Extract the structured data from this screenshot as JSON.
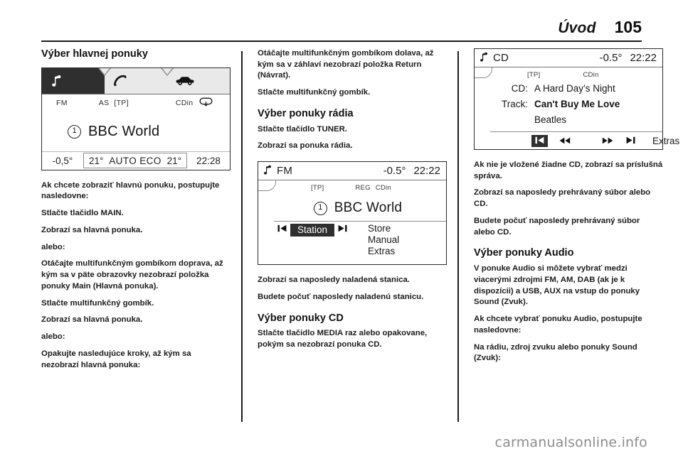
{
  "header": {
    "title": "Úvod",
    "page_number": "105"
  },
  "footer": {
    "watermark": "carmanualsonline.info"
  },
  "columns": {
    "left": {
      "heading": "Výber hlavnej ponuky",
      "paragraphs": [
        "Ak chcete zobraziť hlavnú ponuku, postupujte nasledovne:",
        "Stlačte tlačidlo MAIN.",
        "Zobrazí sa hlavná ponuka.",
        "alebo:",
        "Otáčajte multifunkčným gombíkom doprava, až kým sa v päte obrazovky nezobrazí položka ponuky Main (Hlavná ponuka).",
        "Stlačte multifunkčný gombík.",
        "Zobrazí sa hlavná ponuka.",
        "alebo:",
        "Opakujte nasledujúce kroky, až kým sa nezobrazí hlavná ponuka:"
      ]
    },
    "middle": {
      "paragraphs_top": [
        "Otáčajte multifunkčným gombíkom dolava, až kým sa v záhlaví nezobrazí položka Return (Návrat).",
        "Stlačte multifunkčný gombík."
      ],
      "heading_radio": "Výber ponuky rádia",
      "paragraphs_radio": [
        "Stlačte tlačidlo TUNER.",
        "Zobrazí sa ponuka rádia."
      ],
      "paragraphs_after_screen": [
        "Zobrazí sa naposledy naladená stanica.",
        "Budete počuť naposledy naladenú stanicu."
      ],
      "heading_cd": "Výber ponuky CD",
      "paragraphs_cd": [
        "Stlačte tlačidlo MEDIA raz alebo opakovane, pokým sa nezobrazí ponuka CD."
      ]
    },
    "right": {
      "paragraphs_top": [
        "Ak nie je vložené žiadne CD, zobrazí sa príslušná správa.",
        "Zobrazí sa naposledy prehrávaný súbor alebo CD.",
        "Budete počuť naposledy prehrávaný súbor alebo CD."
      ],
      "heading_audio": "Výber ponuky Audio",
      "paragraphs_audio": [
        "V ponuke Audio si môžete vybrať medzi viacerými zdrojmi FM, AM, DAB (ak je k dispozícii) a USB, AUX na vstup do ponuky Sound (Zvuk).",
        "Ak chcete vybrať ponuku Audio, postupujte nasledovne:",
        "Na rádiu, zdroj zvuku alebo ponuky Sound (Zvuk):"
      ]
    }
  },
  "screens": {
    "main_menu": {
      "tabs": [
        {
          "icon": "music-note-icon",
          "active": true
        },
        {
          "icon": "phone-handset-icon",
          "active": false
        },
        {
          "icon": "car-icon",
          "active": false
        }
      ],
      "status": {
        "band": "FM",
        "autostore": "AS",
        "traffic": "[TP]",
        "cd_status": "CDin",
        "loop": "loop-icon"
      },
      "preset": "1",
      "station": "BBC World",
      "bottom_bar": {
        "outside_temp": "-0,5°",
        "left_temp": "21°",
        "climate_mode": "AUTO ECO",
        "right_temp": "21°",
        "clock": "22:28"
      }
    },
    "tuner_menu": {
      "title_icon": "music-note-icon",
      "source": "FM",
      "outside_temp": "-0.5°",
      "clock": "22:22",
      "sub": {
        "traffic": "[TP]",
        "regional": "REG",
        "cd_status": "CDin"
      },
      "preset": "1",
      "station": "BBC World",
      "prev_icon": "skip-back-icon",
      "next_icon": "skip-forward-icon",
      "selected_item": "Station",
      "items": [
        "Store",
        "Manual",
        "Extras"
      ]
    },
    "cd_menu": {
      "title_icon": "music-note-icon",
      "source": "CD",
      "outside_temp": "-0.5°",
      "clock": "22:22",
      "sub": {
        "traffic": "[TP]",
        "cd_status": "CDin"
      },
      "rows": [
        {
          "label": "CD:",
          "value": "A Hard Day’s Night",
          "bold": false
        },
        {
          "label": "Track:",
          "value": "Can't Buy Me Love",
          "bold": true
        },
        {
          "label": "",
          "value": "Beatles",
          "bold": false
        }
      ],
      "controls": {
        "skip_back": "skip-back-icon",
        "rewind": "rewind-icon",
        "fast_forward": "fast-forward-icon",
        "skip_forward": "skip-forward-icon",
        "extras": "Extras"
      }
    }
  }
}
